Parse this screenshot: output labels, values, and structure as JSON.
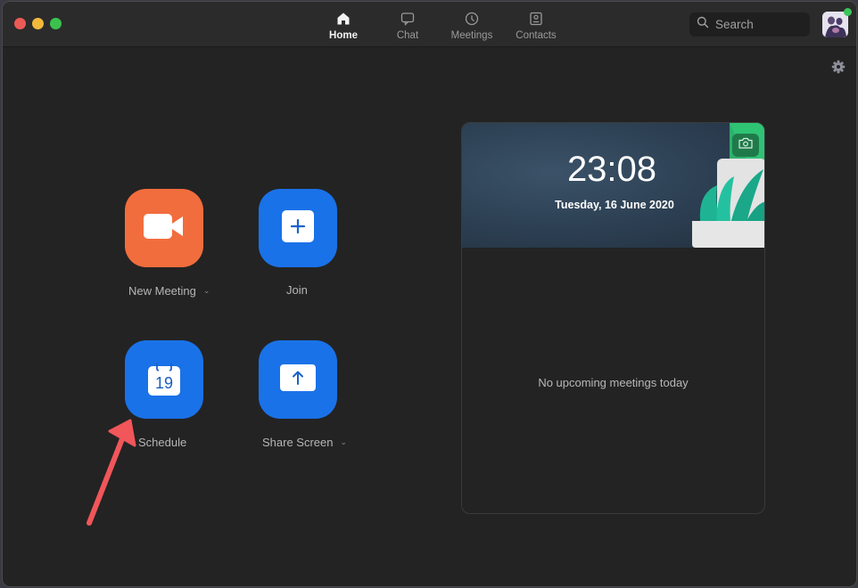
{
  "window": {
    "traffic_lights": [
      "close",
      "minimize",
      "maximize"
    ]
  },
  "nav": {
    "tabs": [
      {
        "label": "Home",
        "icon": "home-icon",
        "active": true
      },
      {
        "label": "Chat",
        "icon": "chat-icon",
        "active": false
      },
      {
        "label": "Meetings",
        "icon": "clock-icon",
        "active": false
      },
      {
        "label": "Contacts",
        "icon": "contacts-icon",
        "active": false
      }
    ]
  },
  "search": {
    "placeholder": "Search",
    "icon": "search-icon"
  },
  "profile": {
    "status": "online",
    "status_color": "#3cc35a"
  },
  "actions": {
    "new_meeting": {
      "label": "New Meeting",
      "has_dropdown": true,
      "color": "#f26d3d",
      "icon": "video-camera-icon"
    },
    "join": {
      "label": "Join",
      "has_dropdown": false,
      "color": "#1a72e8",
      "icon": "plus-icon"
    },
    "schedule": {
      "label": "Schedule",
      "has_dropdown": false,
      "color": "#1a72e8",
      "icon": "calendar-icon",
      "calendar_day": "19"
    },
    "share_screen": {
      "label": "Share Screen",
      "has_dropdown": true,
      "color": "#1a72e8",
      "icon": "share-arrow-icon"
    }
  },
  "chevron_glyph": "⌄",
  "upcoming": {
    "time": "23:08",
    "date": "Tuesday, 16 June 2020",
    "empty_message": "No upcoming meetings today"
  },
  "annotation": {
    "arrow_color": "#f0565a",
    "points_to": "schedule"
  }
}
